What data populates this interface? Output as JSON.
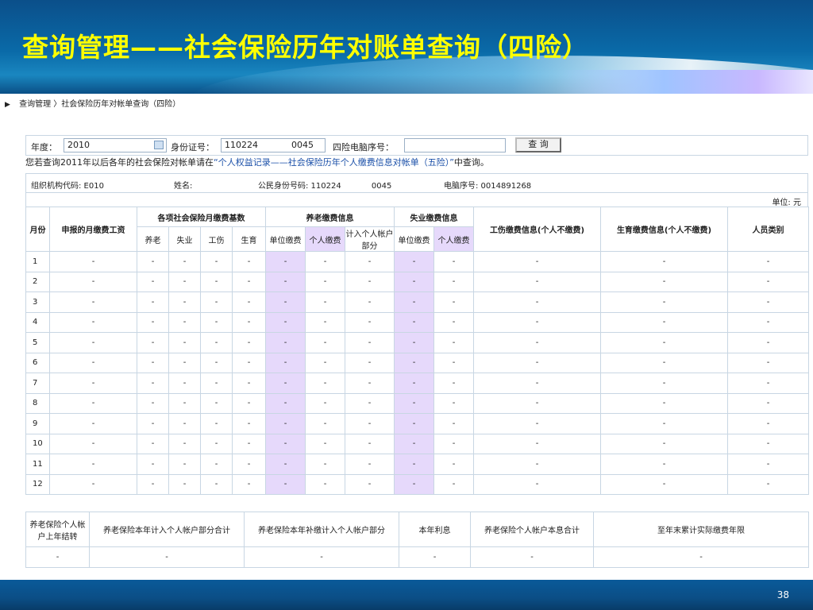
{
  "slide": {
    "title": "查询管理——社会保险历年对账单查询（四险）",
    "page_number": "38"
  },
  "breadcrumb": {
    "arrow": "▶",
    "text": "查询管理 〉社会保险历年对帐单查询（四险）"
  },
  "search": {
    "year_label": "年度：",
    "year_value": "2010",
    "id_label": "身份证号：",
    "id_value": "110224            0045",
    "seq_label": "四险电脑序号：",
    "seq_value": "",
    "query_button": "查 询"
  },
  "notice": {
    "prefix": "您若查询2011年以后各年的社会保险对帐单请在",
    "link": "“个人权益记录——社会保险历年个人缴费信息对帐单（五险）”",
    "suffix": "中查询。"
  },
  "info": {
    "org": "组织机构代码: E010",
    "name": "姓名:",
    "citizen_id": "公民身份号码: 110224            0045",
    "pc_seq": "电脑序号: 0014891268"
  },
  "unit": "单位: 元",
  "table": {
    "headers": {
      "month": "月份",
      "declared": "申报的月缴费工资",
      "base_group": "各项社会保险月缴费基数",
      "base_cols": [
        "养老",
        "失业",
        "工伤",
        "生育"
      ],
      "pension_group": "养老缴费信息",
      "pension_cols": [
        "单位缴费",
        "个人缴费",
        "计入个人帐户部分"
      ],
      "unemp_group": "失业缴费信息",
      "unemp_cols": [
        "单位缴费",
        "个人缴费"
      ],
      "injury": "工伤缴费信息(个人不缴费)",
      "maternity": "生育缴费信息(个人不缴费)",
      "category": "人员类别"
    },
    "rows": [
      {
        "m": "1",
        "c": [
          "-",
          "-",
          "-",
          "-",
          "-",
          "-",
          "-",
          "-",
          "-",
          "-",
          "-",
          "-",
          "-"
        ]
      },
      {
        "m": "2",
        "c": [
          "-",
          "-",
          "-",
          "-",
          "-",
          "-",
          "-",
          "-",
          "-",
          "-",
          "-",
          "-",
          "-"
        ]
      },
      {
        "m": "3",
        "c": [
          "-",
          "-",
          "-",
          "-",
          "-",
          "-",
          "-",
          "-",
          "-",
          "-",
          "-",
          "-",
          "-"
        ]
      },
      {
        "m": "4",
        "c": [
          "-",
          "-",
          "-",
          "-",
          "-",
          "-",
          "-",
          "-",
          "-",
          "-",
          "-",
          "-",
          "-"
        ]
      },
      {
        "m": "5",
        "c": [
          "-",
          "-",
          "-",
          "-",
          "-",
          "-",
          "-",
          "-",
          "-",
          "-",
          "-",
          "-",
          "-"
        ]
      },
      {
        "m": "6",
        "c": [
          "-",
          "-",
          "-",
          "-",
          "-",
          "-",
          "-",
          "-",
          "-",
          "-",
          "-",
          "-",
          "-"
        ]
      },
      {
        "m": "7",
        "c": [
          "-",
          "-",
          "-",
          "-",
          "-",
          "-",
          "-",
          "-",
          "-",
          "-",
          "-",
          "-",
          "-"
        ]
      },
      {
        "m": "8",
        "c": [
          "-",
          "-",
          "-",
          "-",
          "-",
          "-",
          "-",
          "-",
          "-",
          "-",
          "-",
          "-",
          "-"
        ]
      },
      {
        "m": "9",
        "c": [
          "-",
          "-",
          "-",
          "-",
          "-",
          "-",
          "-",
          "-",
          "-",
          "-",
          "-",
          "-",
          "-"
        ]
      },
      {
        "m": "10",
        "c": [
          "-",
          "-",
          "-",
          "-",
          "-",
          "-",
          "-",
          "-",
          "-",
          "-",
          "-",
          "-",
          "-"
        ]
      },
      {
        "m": "11",
        "c": [
          "-",
          "-",
          "-",
          "-",
          "-",
          "-",
          "-",
          "-",
          "-",
          "-",
          "-",
          "-",
          "-"
        ]
      },
      {
        "m": "12",
        "c": [
          "-",
          "-",
          "-",
          "-",
          "-",
          "-",
          "-",
          "-",
          "-",
          "-",
          "-",
          "-",
          "-"
        ]
      }
    ]
  },
  "summary": {
    "headers": [
      "养老保险个人帐户上年结转",
      "养老保险本年计入个人帐户部分合计",
      "养老保险本年补缴计入个人帐户部分",
      "本年利息",
      "养老保险个人帐户本息合计",
      "至年末累计实际缴费年限"
    ],
    "values": [
      "-",
      "-",
      "-",
      "-",
      "-",
      "-"
    ]
  },
  "colors": {
    "title": "#ffff00",
    "personal_highlight": "#e6d9fb",
    "border": "#c8d6e3",
    "link": "#1a4fa8"
  }
}
